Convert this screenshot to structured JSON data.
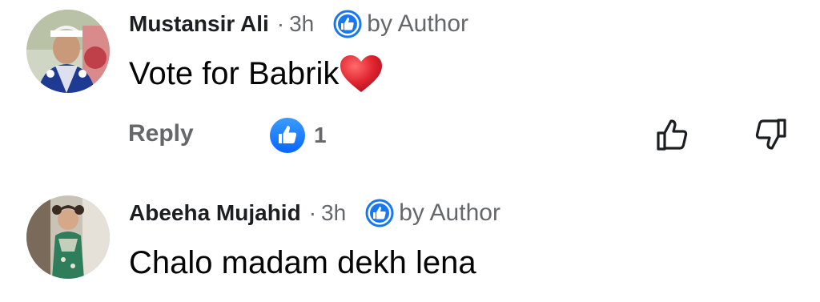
{
  "comments": [
    {
      "author": "Mustansir Ali",
      "separator": "·",
      "time": "3h",
      "badge_icon": "like-badge-icon",
      "badge_label": "by Author",
      "text": "Vote for Babrik",
      "emoji_icon": "red-heart-icon",
      "reply_label": "Reply",
      "reaction_icon": "like-reaction-icon",
      "reaction_count": "1",
      "like_icon": "thumbs-up-outline-icon",
      "dislike_icon": "thumbs-down-outline-icon"
    },
    {
      "author": "Abeeha Mujahid",
      "separator": "·",
      "time": "3h",
      "badge_icon": "like-badge-icon",
      "badge_label": "by Author",
      "text": "Chalo madam dekh lena"
    }
  ],
  "colors": {
    "accent_blue": "#1877f2",
    "secondary_text": "#65676b",
    "primary_text": "#050505",
    "heart_red": "#e0242f"
  }
}
